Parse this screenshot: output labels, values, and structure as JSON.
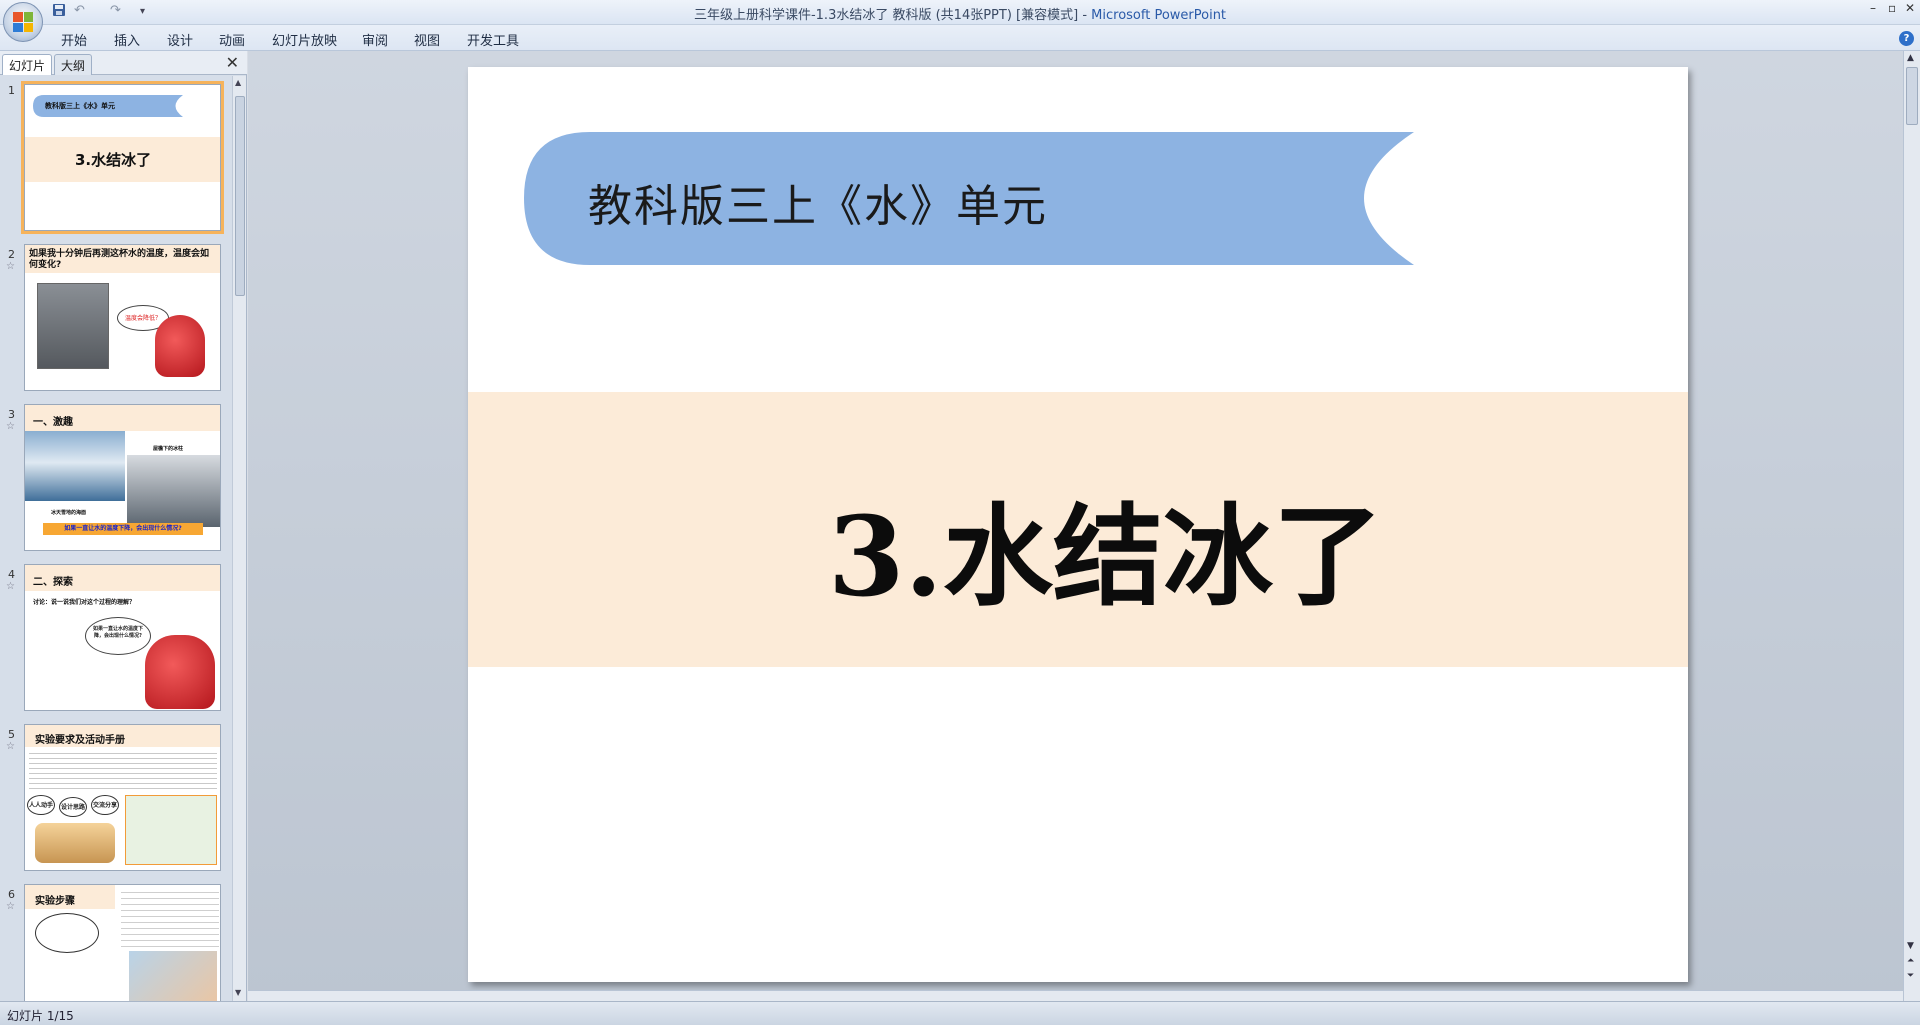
{
  "window": {
    "title": "三年级上册科学课件-1.3水结冰了  教科版   (共14张PPT) [兼容模式]",
    "app_name": "Microsoft PowerPoint",
    "controls": [
      "–",
      "▫",
      "✕"
    ]
  },
  "quick_access": {
    "save_icon": "save-icon",
    "undo_label": "↶",
    "redo_label": "↷",
    "customize_label": "▾"
  },
  "ribbon": {
    "tabs": [
      "开始",
      "插入",
      "设计",
      "动画",
      "幻灯片放映",
      "审阅",
      "视图",
      "开发工具"
    ],
    "help": "?"
  },
  "panel": {
    "tabs": [
      "幻灯片",
      "大纲"
    ],
    "close_label": "✕",
    "thumbnails": [
      {
        "num": "1",
        "banner": "教科版三上《水》单元",
        "title": "3.水结冰了"
      },
      {
        "num": "2",
        "title": "如果我十分钟后再测这杯水的温度，温度会如何变化?",
        "bubble": "温度会降低？"
      },
      {
        "num": "3",
        "title": "一、激趣",
        "caption1": "冰天雪地的海面",
        "caption2": "屋檐下的冰柱",
        "footer": "如果一直让水的温度下降，会出现什么情况?"
      },
      {
        "num": "4",
        "title": "二、探索",
        "subtitle": "讨论：说一说我们对这个过程的理解？",
        "bubble": "如果一直让水的温度下降，会出现什么情况?"
      },
      {
        "num": "5",
        "title": "实验要求及活动手册",
        "bubbles": [
          "人人动手",
          "设计思路",
          "交流分享"
        ]
      },
      {
        "num": "6",
        "title": "实验步骤"
      }
    ]
  },
  "slide": {
    "banner_text": "教科版三上《水》单元",
    "title": "3.水结冰了",
    "banner_color": "#8db3e2",
    "band_color": "#fcebd8"
  },
  "status": {
    "slide_indicator": "幻灯片 1/15"
  }
}
